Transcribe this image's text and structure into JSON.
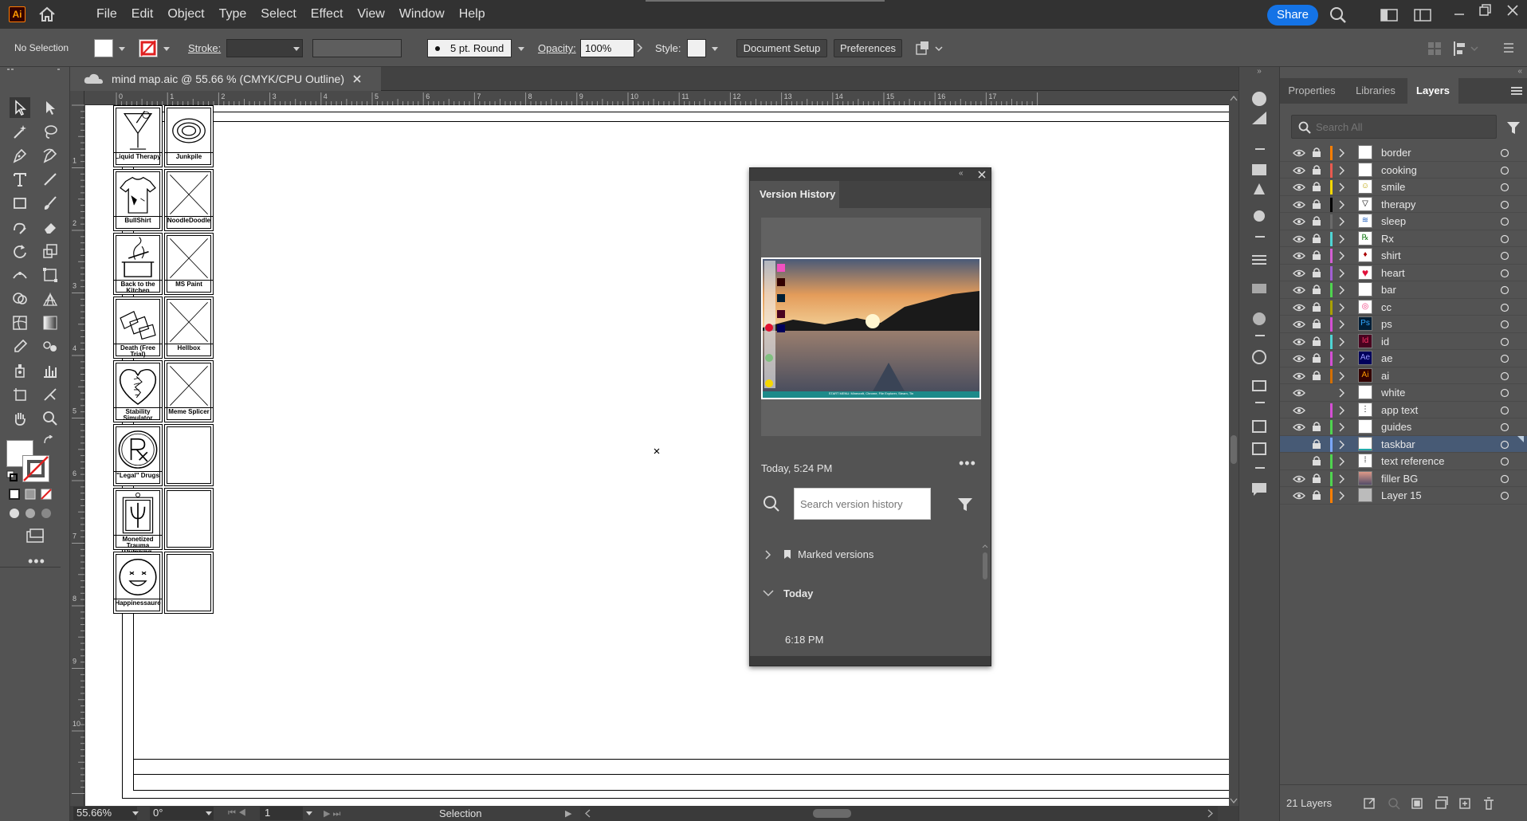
{
  "app": {
    "logo": "Ai"
  },
  "menu": [
    "File",
    "Edit",
    "Object",
    "Type",
    "Select",
    "Effect",
    "View",
    "Window",
    "Help"
  ],
  "share_label": "Share",
  "control": {
    "selection": "No Selection",
    "stroke_label": "Stroke:",
    "brush": "5 pt. Round",
    "opacity_label": "Opacity:",
    "opacity_value": "100%",
    "style_label": "Style:",
    "document_setup": "Document Setup",
    "preferences": "Preferences"
  },
  "doc_tab": {
    "title": "mind map.aic @ 55.66 % (CMYK/CPU Outline)"
  },
  "ruler_h": [
    "0",
    "1",
    "2",
    "3",
    "4",
    "5",
    "6",
    "7",
    "8",
    "9",
    "10",
    "11",
    "12",
    "13",
    "14",
    "15",
    "16",
    "17"
  ],
  "ruler_v": [
    "1",
    "2",
    "3",
    "4",
    "5",
    "6",
    "7",
    "8",
    "9",
    "10"
  ],
  "cards": [
    {
      "label": "Liquid Therapy",
      "icon": "martini"
    },
    {
      "label": "Junkpile",
      "icon": "cc-swirl"
    },
    {
      "label": "BullShirt",
      "icon": "shirt"
    },
    {
      "label": "NoodleDoodle",
      "icon": "placeholder"
    },
    {
      "label": "Back to the Kitchen",
      "icon": "pot"
    },
    {
      "label": "MS Paint",
      "icon": "placeholder"
    },
    {
      "label": "Death (Free Trial)",
      "icon": "papers"
    },
    {
      "label": "Hellbox",
      "icon": "placeholder"
    },
    {
      "label": "Stability Simulator",
      "icon": "stitched-heart"
    },
    {
      "label": "Meme Splicer",
      "icon": "placeholder"
    },
    {
      "label": "\"Legal\" Drugs",
      "icon": "rx"
    },
    {
      "label": "",
      "icon": "empty"
    },
    {
      "label": "Monetized Trauma Dumping",
      "icon": "psi-jar"
    },
    {
      "label": "",
      "icon": "empty"
    },
    {
      "label": "Happinessaure",
      "icon": "smile"
    },
    {
      "label": "",
      "icon": "empty"
    }
  ],
  "version_history": {
    "title": "Version History",
    "timestamp": "Today, 5:24 PM",
    "search_placeholder": "Search version history",
    "marked": "Marked versions",
    "today": "Today",
    "entry": "6:18 PM",
    "thumb_caption": "START MENU: Minecraft, Chrome, File Explorer, Steam, Tin"
  },
  "panel_tabs": [
    "Properties",
    "Libraries",
    "Layers"
  ],
  "layer_search_placeholder": "Search All",
  "layers": [
    {
      "name": "border",
      "color": "#ff7f00",
      "visible": true,
      "locked": true,
      "thumb": "white"
    },
    {
      "name": "cooking",
      "color": "#e95a4f",
      "visible": true,
      "locked": true,
      "thumb": "white"
    },
    {
      "name": "smile",
      "color": "#f5d700",
      "visible": true,
      "locked": true,
      "thumb": "smile"
    },
    {
      "name": "therapy",
      "color": "#000000",
      "visible": true,
      "locked": true,
      "thumb": "therapy"
    },
    {
      "name": "sleep",
      "color": "#6a6a6a",
      "visible": true,
      "locked": true,
      "thumb": "sleep"
    },
    {
      "name": "Rx",
      "color": "#4fd4d4",
      "visible": true,
      "locked": true,
      "thumb": "rx"
    },
    {
      "name": "shirt",
      "color": "#d45fd4",
      "visible": true,
      "locked": true,
      "thumb": "shirt"
    },
    {
      "name": "heart",
      "color": "#a25fd4",
      "visible": true,
      "locked": true,
      "thumb": "heart"
    },
    {
      "name": "bar",
      "color": "#4fd44f",
      "visible": true,
      "locked": true,
      "thumb": "white"
    },
    {
      "name": "cc",
      "color": "#aaa000",
      "visible": true,
      "locked": true,
      "thumb": "cc"
    },
    {
      "name": "ps",
      "color": "#d44fd4",
      "visible": true,
      "locked": true,
      "thumb": "ps"
    },
    {
      "name": "id",
      "color": "#4fd4d4",
      "visible": true,
      "locked": true,
      "thumb": "id"
    },
    {
      "name": "ae",
      "color": "#d44fd4",
      "visible": true,
      "locked": true,
      "thumb": "ae"
    },
    {
      "name": "ai",
      "color": "#d46f00",
      "visible": true,
      "locked": true,
      "thumb": "ai"
    },
    {
      "name": "white",
      "color": "#535353",
      "visible": true,
      "locked": false,
      "thumb": "white"
    },
    {
      "name": "app text",
      "color": "#d44fd4",
      "visible": true,
      "locked": false,
      "thumb": "apptext"
    },
    {
      "name": "guides",
      "color": "#4fd44f",
      "visible": true,
      "locked": true,
      "thumb": "white"
    },
    {
      "name": "taskbar",
      "color": "#7aa7ff",
      "visible": false,
      "locked": true,
      "thumb": "taskbar"
    },
    {
      "name": "text reference",
      "color": "#4fd44f",
      "visible": false,
      "locked": true,
      "thumb": "textref"
    },
    {
      "name": "filler BG",
      "color": "#4fd44f",
      "visible": true,
      "locked": true,
      "thumb": "fillerbg"
    },
    {
      "name": "Layer 15",
      "color": "#ff7f00",
      "visible": true,
      "locked": true,
      "thumb": "layer15"
    }
  ],
  "layers_count": "21 Layers",
  "status": {
    "zoom": "55.66%",
    "rotate": "0°",
    "artboard": "1",
    "tool": "Selection"
  },
  "colors": {
    "accent": "#1473e6",
    "selected_row": "#475a75",
    "panel": "#535353",
    "dark": "#323232"
  }
}
